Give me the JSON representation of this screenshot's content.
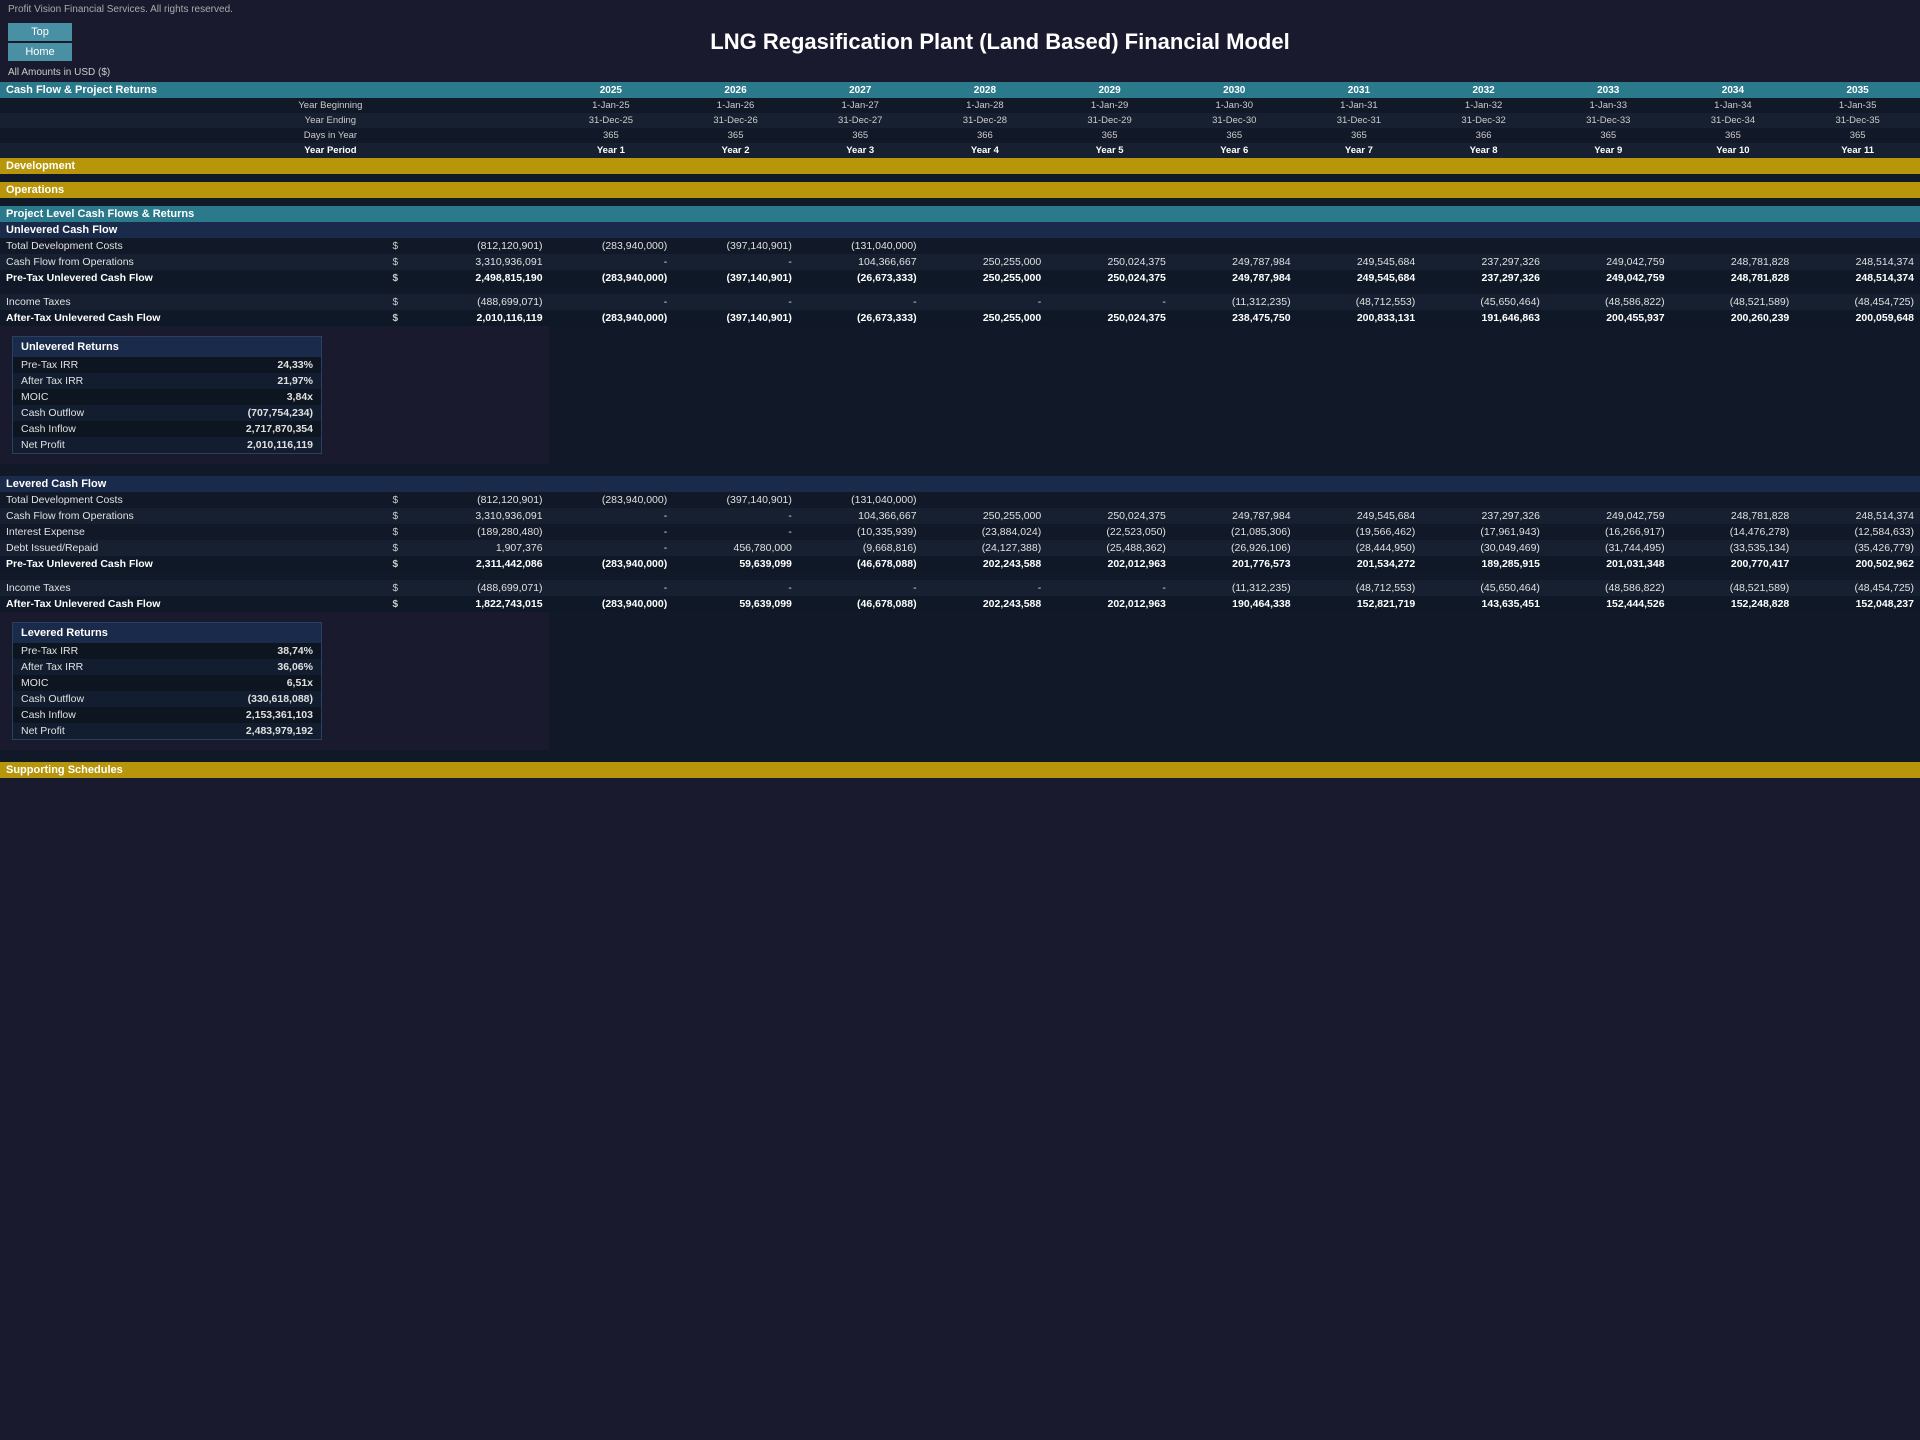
{
  "company": "Profit Vision Financial Services. All rights reserved.",
  "page_title": "LNG Regasification Plant (Land Based) Financial Model",
  "nav": {
    "top_label": "Top",
    "home_label": "Home"
  },
  "amounts_label": "All Amounts in  USD ($)",
  "sections": {
    "cash_flow_returns": "Cash Flow & Project Returns",
    "development": "Development",
    "operations": "Operations",
    "project_level": "Project Level Cash Flows & Returns",
    "unlevered_cash_flow": "Unlevered Cash Flow",
    "unlevered_returns": "Unlevered Returns",
    "levered_cash_flow": "Levered Cash Flow",
    "levered_returns": "Levered Returns",
    "supporting_schedules": "Supporting Schedules"
  },
  "columns": {
    "years": [
      "2025",
      "2026",
      "2027",
      "2028",
      "2029",
      "2030",
      "2031",
      "2032",
      "2033",
      "2034",
      "2035"
    ],
    "year_axis_label": "Year",
    "year_beginning": [
      "1-Jan-25",
      "1-Jan-26",
      "1-Jan-27",
      "1-Jan-28",
      "1-Jan-29",
      "1-Jan-30",
      "1-Jan-31",
      "1-Jan-32",
      "1-Jan-33",
      "1-Jan-34",
      "1-Jan-35"
    ],
    "year_ending": [
      "31-Dec-25",
      "31-Dec-26",
      "31-Dec-27",
      "31-Dec-28",
      "31-Dec-29",
      "31-Dec-30",
      "31-Dec-31",
      "31-Dec-32",
      "31-Dec-33",
      "31-Dec-34",
      "31-Dec-35"
    ],
    "days_in_year": [
      "365",
      "365",
      "365",
      "366",
      "365",
      "365",
      "365",
      "366",
      "365",
      "365",
      "365"
    ],
    "year_period": [
      "Year 1",
      "Year 2",
      "Year 3",
      "Year 4",
      "Year 5",
      "Year 6",
      "Year 7",
      "Year 8",
      "Year 9",
      "Year 10",
      "Year 11"
    ]
  },
  "unlevered": {
    "total_dev_costs_label": "Total Development Costs",
    "total_dev_costs_currency": "$",
    "total_dev_costs_base": "(812,120,901)",
    "total_dev_costs": [
      "(283,940,000)",
      "(397,140,901)",
      "(131,040,000)",
      "",
      "",
      "",
      "",
      "",
      "",
      "",
      ""
    ],
    "cfo_label": "Cash Flow from Operations",
    "cfo_currency": "$",
    "cfo_base": "3,310,936,091",
    "cfo": [
      "-",
      "-",
      "104,366,667",
      "250,255,000",
      "250,024,375",
      "249,787,984",
      "249,545,684",
      "237,297,326",
      "249,042,759",
      "248,781,828",
      "248,514,374"
    ],
    "pre_tax_label": "Pre-Tax Unlevered Cash Flow",
    "pre_tax_currency": "$",
    "pre_tax_base": "2,498,815,190",
    "pre_tax": [
      "(283,940,000)",
      "(397,140,901)",
      "(26,673,333)",
      "250,255,000",
      "250,024,375",
      "249,787,984",
      "249,545,684",
      "237,297,326",
      "249,042,759",
      "248,781,828",
      "248,514,374"
    ],
    "income_tax_label": "Income Taxes",
    "income_tax_currency": "$",
    "income_tax_base": "(488,699,071)",
    "income_tax": [
      "-",
      "-",
      "-",
      "-",
      "-",
      "(11,312,235)",
      "(48,712,553)",
      "(45,650,464)",
      "(48,586,822)",
      "(48,521,589)",
      "(48,454,725)"
    ],
    "after_tax_label": "After-Tax Unlevered Cash Flow",
    "after_tax_currency": "$",
    "after_tax_base": "2,010,116,119",
    "after_tax": [
      "(283,940,000)",
      "(397,140,901)",
      "(26,673,333)",
      "250,255,000",
      "250,024,375",
      "238,475,750",
      "200,833,131",
      "191,646,863",
      "200,455,937",
      "200,260,239",
      "200,059,648"
    ]
  },
  "unlevered_returns_data": {
    "pre_tax_irr_label": "Pre-Tax IRR",
    "pre_tax_irr_val": "24,33%",
    "after_tax_irr_label": "After Tax IRR",
    "after_tax_irr_val": "21,97%",
    "moic_label": "MOIC",
    "moic_val": "3,84x",
    "cash_outflow_label": "Cash Outflow",
    "cash_outflow_val": "(707,754,234)",
    "cash_inflow_label": "Cash Inflow",
    "cash_inflow_val": "2,717,870,354",
    "net_profit_label": "Net Profit",
    "net_profit_val": "2,010,116,119"
  },
  "levered": {
    "total_dev_costs_label": "Total Development Costs",
    "total_dev_costs_currency": "$",
    "total_dev_costs_base": "(812,120,901)",
    "total_dev_costs": [
      "(283,940,000)",
      "(397,140,901)",
      "(131,040,000)",
      "",
      "",
      "",
      "",
      "",
      "",
      "",
      ""
    ],
    "cfo_label": "Cash Flow from Operations",
    "cfo_currency": "$",
    "cfo_base": "3,310,936,091",
    "cfo": [
      "-",
      "-",
      "104,366,667",
      "250,255,000",
      "250,024,375",
      "249,787,984",
      "249,545,684",
      "237,297,326",
      "249,042,759",
      "248,781,828",
      "248,514,374"
    ],
    "interest_label": "Interest Expense",
    "interest_currency": "$",
    "interest_base": "(189,280,480)",
    "interest": [
      "-",
      "-",
      "(10,335,939)",
      "(23,884,024)",
      "(22,523,050)",
      "(21,085,306)",
      "(19,566,462)",
      "(17,961,943)",
      "(16,266,917)",
      "(14,476,278)",
      "(12,584,633)"
    ],
    "debt_label": "Debt Issued/Repaid",
    "debt_currency": "$",
    "debt_base": "1,907,376",
    "debt": [
      "-",
      "456,780,000",
      "(9,668,816)",
      "(24,127,388)",
      "(25,488,362)",
      "(26,926,106)",
      "(28,444,950)",
      "(30,049,469)",
      "(31,744,495)",
      "(33,535,134)",
      "(35,426,779)"
    ],
    "pre_tax_label": "Pre-Tax Unlevered Cash Flow",
    "pre_tax_currency": "$",
    "pre_tax_base": "2,311,442,086",
    "pre_tax": [
      "(283,940,000)",
      "59,639,099",
      "(46,678,088)",
      "202,243,588",
      "202,012,963",
      "201,776,573",
      "201,534,272",
      "189,285,915",
      "201,031,348",
      "200,770,417",
      "200,502,962"
    ],
    "income_tax_label": "Income Taxes",
    "income_tax_currency": "$",
    "income_tax_base": "(488,699,071)",
    "income_tax": [
      "-",
      "-",
      "-",
      "-",
      "-",
      "(11,312,235)",
      "(48,712,553)",
      "(45,650,464)",
      "(48,586,822)",
      "(48,521,589)",
      "(48,454,725)"
    ],
    "after_tax_label": "After-Tax Unlevered Cash Flow",
    "after_tax_currency": "$",
    "after_tax_base": "1,822,743,015",
    "after_tax": [
      "(283,940,000)",
      "59,639,099",
      "(46,678,088)",
      "202,243,588",
      "202,012,963",
      "190,464,338",
      "152,821,719",
      "143,635,451",
      "152,444,526",
      "152,248,828",
      "152,048,237"
    ]
  },
  "levered_returns_data": {
    "pre_tax_irr_label": "Pre-Tax IRR",
    "pre_tax_irr_val": "38,74%",
    "after_tax_irr_label": "After Tax IRR",
    "after_tax_irr_val": "36,06%",
    "moic_label": "MOIC",
    "moic_val": "6,51x",
    "cash_outflow_label": "Cash Outflow",
    "cash_outflow_val": "(330,618,088)",
    "cash_inflow_label": "Cash Inflow",
    "cash_inflow_val": "2,153,361,103",
    "net_profit_label": "Net Profit",
    "net_profit_val": "2,483,979,192"
  }
}
